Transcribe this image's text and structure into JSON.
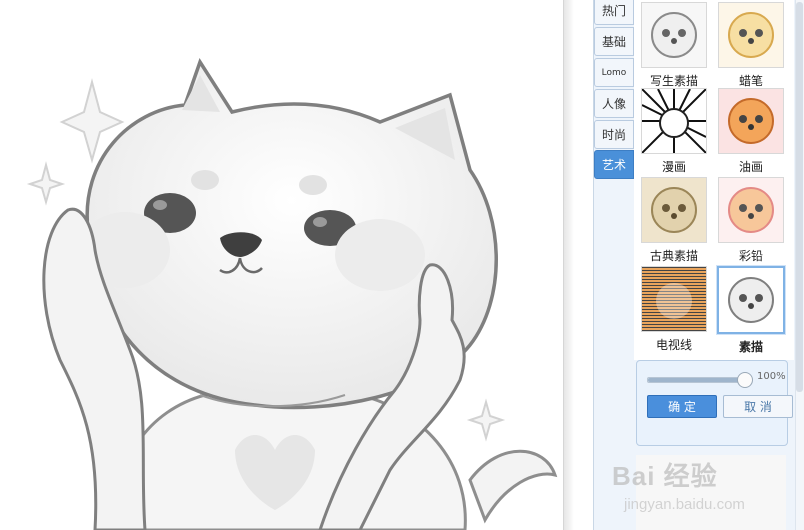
{
  "categories": [
    {
      "label": "热门",
      "active": false
    },
    {
      "label": "基础",
      "active": false
    },
    {
      "label": "Lomo",
      "active": false
    },
    {
      "label": "人像",
      "active": false
    },
    {
      "label": "时尚",
      "active": false
    },
    {
      "label": "艺术",
      "active": true
    }
  ],
  "effects": [
    {
      "label": "写生素描",
      "selected": false
    },
    {
      "label": "蜡笔",
      "selected": false
    },
    {
      "label": "漫画",
      "selected": false
    },
    {
      "label": "油画",
      "selected": false
    },
    {
      "label": "古典素描",
      "selected": false
    },
    {
      "label": "彩铅",
      "selected": false
    },
    {
      "label": "电视线",
      "selected": false
    },
    {
      "label": "素描",
      "selected": true
    }
  ],
  "adjust": {
    "intensity": 100,
    "intensity_text": "100%",
    "ok_label": "确 定",
    "cancel_label": "取 消"
  },
  "watermark": {
    "main": "Bai 经验",
    "sub": "jingyan.baidu.com"
  },
  "colors": {
    "accent": "#4a90d9",
    "panel_bg": "#eef4fb"
  }
}
